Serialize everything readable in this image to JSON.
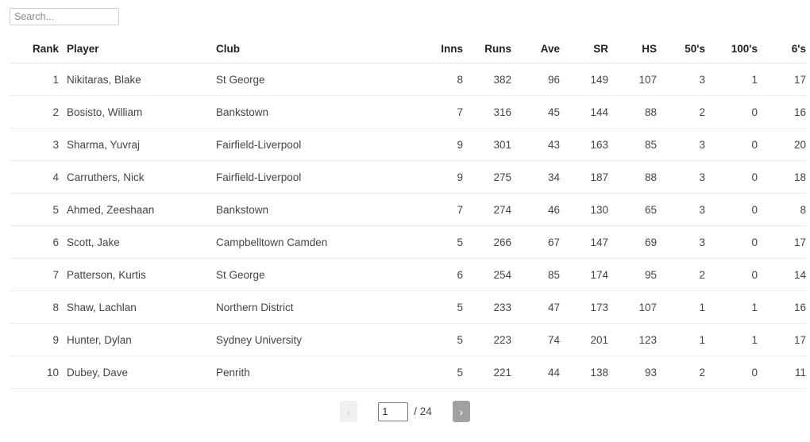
{
  "search": {
    "placeholder": "Search...",
    "value": ""
  },
  "table": {
    "columns": [
      {
        "key": "rank",
        "label": "Rank"
      },
      {
        "key": "player",
        "label": "Player"
      },
      {
        "key": "club",
        "label": "Club"
      },
      {
        "key": "inns",
        "label": "Inns"
      },
      {
        "key": "runs",
        "label": "Runs"
      },
      {
        "key": "ave",
        "label": "Ave"
      },
      {
        "key": "sr",
        "label": "SR"
      },
      {
        "key": "hs",
        "label": "HS"
      },
      {
        "key": "fifties",
        "label": "50's"
      },
      {
        "key": "hundreds",
        "label": "100's"
      },
      {
        "key": "sixes",
        "label": "6's"
      }
    ],
    "rows": [
      {
        "rank": "1",
        "player": "Nikitaras, Blake",
        "club": "St George",
        "inns": "8",
        "runs": "382",
        "ave": "96",
        "sr": "149",
        "hs": "107",
        "fifties": "3",
        "hundreds": "1",
        "sixes": "17"
      },
      {
        "rank": "2",
        "player": "Bosisto, William",
        "club": "Bankstown",
        "inns": "7",
        "runs": "316",
        "ave": "45",
        "sr": "144",
        "hs": "88",
        "fifties": "2",
        "hundreds": "0",
        "sixes": "16"
      },
      {
        "rank": "3",
        "player": "Sharma, Yuvraj",
        "club": "Fairfield-Liverpool",
        "inns": "9",
        "runs": "301",
        "ave": "43",
        "sr": "163",
        "hs": "85",
        "fifties": "3",
        "hundreds": "0",
        "sixes": "20"
      },
      {
        "rank": "4",
        "player": "Carruthers, Nick",
        "club": "Fairfield-Liverpool",
        "inns": "9",
        "runs": "275",
        "ave": "34",
        "sr": "187",
        "hs": "88",
        "fifties": "3",
        "hundreds": "0",
        "sixes": "18"
      },
      {
        "rank": "5",
        "player": "Ahmed, Zeeshaan",
        "club": "Bankstown",
        "inns": "7",
        "runs": "274",
        "ave": "46",
        "sr": "130",
        "hs": "65",
        "fifties": "3",
        "hundreds": "0",
        "sixes": "8"
      },
      {
        "rank": "6",
        "player": "Scott, Jake",
        "club": "Campbelltown Camden",
        "inns": "5",
        "runs": "266",
        "ave": "67",
        "sr": "147",
        "hs": "69",
        "fifties": "3",
        "hundreds": "0",
        "sixes": "17"
      },
      {
        "rank": "7",
        "player": "Patterson, Kurtis",
        "club": "St George",
        "inns": "6",
        "runs": "254",
        "ave": "85",
        "sr": "174",
        "hs": "95",
        "fifties": "2",
        "hundreds": "0",
        "sixes": "14"
      },
      {
        "rank": "8",
        "player": "Shaw, Lachlan",
        "club": "Northern District",
        "inns": "5",
        "runs": "233",
        "ave": "47",
        "sr": "173",
        "hs": "107",
        "fifties": "1",
        "hundreds": "1",
        "sixes": "16"
      },
      {
        "rank": "9",
        "player": "Hunter, Dylan",
        "club": "Sydney University",
        "inns": "5",
        "runs": "223",
        "ave": "74",
        "sr": "201",
        "hs": "123",
        "fifties": "1",
        "hundreds": "1",
        "sixes": "17"
      },
      {
        "rank": "10",
        "player": "Dubey, Dave",
        "club": "Penrith",
        "inns": "5",
        "runs": "221",
        "ave": "44",
        "sr": "138",
        "hs": "93",
        "fifties": "2",
        "hundreds": "0",
        "sixes": "11"
      }
    ]
  },
  "pagination": {
    "prev_label": "‹",
    "next_label": "›",
    "current_page": "1",
    "total_label": "/ 24",
    "total_pages": "24"
  },
  "colors": {
    "header_text": "#222222",
    "body_text": "#444444",
    "row_divider": "#ececec",
    "header_divider": "#e3e3e3",
    "next_button_bg": "#a0a0a0",
    "prev_button_bg": "#f0f0f0"
  }
}
